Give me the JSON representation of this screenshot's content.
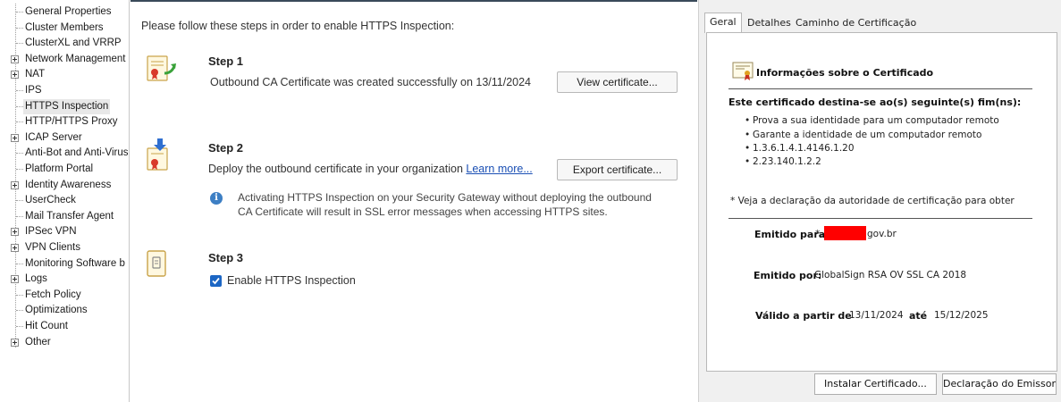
{
  "tree": {
    "items": [
      {
        "label": "General Properties",
        "expandable": false
      },
      {
        "label": "Cluster Members",
        "expandable": false
      },
      {
        "label": "ClusterXL and VRRP",
        "expandable": false
      },
      {
        "label": "Network Management",
        "expandable": true
      },
      {
        "label": "NAT",
        "expandable": true
      },
      {
        "label": "IPS",
        "expandable": false
      },
      {
        "label": "HTTPS Inspection",
        "expandable": false,
        "selected": true
      },
      {
        "label": "HTTP/HTTPS Proxy",
        "expandable": false
      },
      {
        "label": "ICAP Server",
        "expandable": true
      },
      {
        "label": "Anti-Bot and Anti-Virus",
        "expandable": false
      },
      {
        "label": "Platform Portal",
        "expandable": false
      },
      {
        "label": "Identity Awareness",
        "expandable": true
      },
      {
        "label": "UserCheck",
        "expandable": false
      },
      {
        "label": "Mail Transfer Agent",
        "expandable": false
      },
      {
        "label": "IPSec VPN",
        "expandable": true
      },
      {
        "label": "VPN Clients",
        "expandable": true
      },
      {
        "label": "Monitoring Software b",
        "expandable": false
      },
      {
        "label": "Logs",
        "expandable": true
      },
      {
        "label": "Fetch Policy",
        "expandable": false
      },
      {
        "label": "Optimizations",
        "expandable": false
      },
      {
        "label": "Hit Count",
        "expandable": false
      },
      {
        "label": "Other",
        "expandable": true
      }
    ]
  },
  "main": {
    "intro": "Please follow these steps in order to enable HTTPS Inspection:",
    "step1": {
      "title": "Step 1",
      "text": "Outbound CA Certificate was created successfully on 13/11/2024",
      "button": "View certificate..."
    },
    "step2": {
      "title": "Step 2",
      "text": "Deploy the outbound certificate in your organization",
      "link": "Learn more...",
      "button": "Export certificate...",
      "info_line1": "Activating HTTPS Inspection on your Security Gateway without deploying the outbound",
      "info_line2": "CA Certificate will result in SSL error messages when accessing HTTPS sites."
    },
    "step3": {
      "title": "Step 3",
      "checkbox_label": "Enable HTTPS Inspection",
      "checked": true
    }
  },
  "cert_dialog": {
    "tabs": [
      "Geral",
      "Detalhes",
      "Caminho de Certificação"
    ],
    "active_tab": "Geral",
    "title": "Informações sobre o Certificado",
    "purpose_heading": "Este certificado destina-se ao(s) seguinte(s) fim(ns):",
    "purposes": [
      "Prova a sua identidade para um computador remoto",
      "Garante a identidade de um computador remoto",
      "1.3.6.1.4.1.4146.1.20",
      "2.23.140.1.2.2"
    ],
    "note": "* Veja a declaração da autoridade de certificação para obter",
    "issued_to_label": "Emitido para:",
    "issued_to_prefix": "*.",
    "issued_to_suffix": "gov.br",
    "issued_by_label": "Emitido por:",
    "issued_by_value": "GlobalSign RSA OV SSL CA 2018",
    "valid_from_label": "Válido a partir de",
    "valid_from": "13/11/2024",
    "valid_to_label": "até",
    "valid_to": "15/12/2025",
    "install_button": "Instalar Certificado...",
    "issuer_statement_button": "Declaração do Emissor"
  },
  "colors": {
    "accent": "#1c66c4",
    "link": "#1a4fb4",
    "redaction": "#ff0000"
  }
}
